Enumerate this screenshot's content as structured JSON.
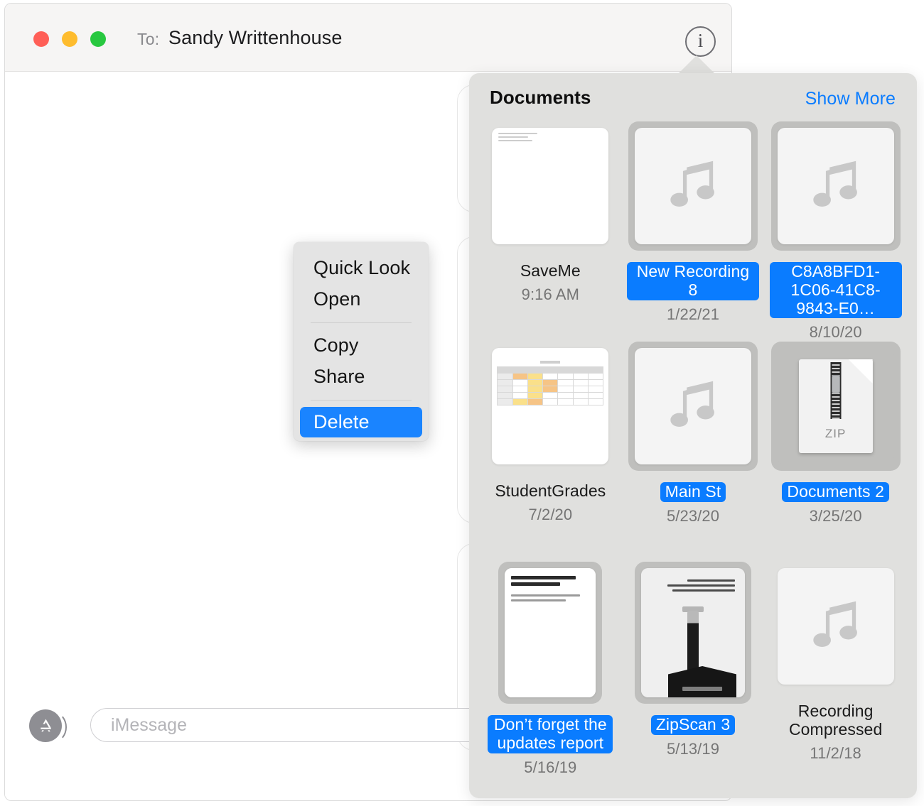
{
  "window": {
    "to_label": "To:",
    "recipient": "Sandy Writtenhouse",
    "info_button_glyph": "i",
    "composer_placeholder": "iMessage",
    "composer_value": ""
  },
  "context_menu": {
    "items": [
      {
        "label": "Quick Look",
        "selected": false
      },
      {
        "label": "Open",
        "selected": false
      },
      {
        "label": "Copy",
        "selected": false
      },
      {
        "label": "Share",
        "selected": false
      },
      {
        "label": "Delete",
        "selected": true
      }
    ]
  },
  "popover": {
    "title": "Documents",
    "show_more": "Show More",
    "items": [
      {
        "name": "SaveMe",
        "date": "9:16 AM",
        "selected": false,
        "kind": "document"
      },
      {
        "name": "New Recording 8",
        "date": "1/22/21",
        "selected": true,
        "kind": "audio"
      },
      {
        "name": "C8A8BFD1-1C06-41C8-9843-E0…",
        "date": "8/10/20",
        "selected": true,
        "kind": "audio"
      },
      {
        "name": "StudentGrades",
        "date": "7/2/20",
        "selected": false,
        "kind": "spreadsheet"
      },
      {
        "name": "Main St",
        "date": "5/23/20",
        "selected": true,
        "kind": "audio"
      },
      {
        "name": "Documents 2",
        "date": "3/25/20",
        "selected": true,
        "kind": "zip",
        "zip_label": "ZIP"
      },
      {
        "name": "Don’t forget the updates report",
        "date": "5/16/19",
        "selected": true,
        "kind": "note"
      },
      {
        "name": "ZipScan 3",
        "date": "5/13/19",
        "selected": true,
        "kind": "scan"
      },
      {
        "name": "Recording Compressed",
        "date": "11/2/18",
        "selected": false,
        "kind": "audio"
      }
    ]
  },
  "colors": {
    "accent_blue": "#0a7cff",
    "menu_highlight": "#1a84ff",
    "popover_bg": "#e0e0de",
    "titlebar_bg": "#f6f5f4",
    "traffic_red": "#ff5f57",
    "traffic_yellow": "#febc2e",
    "traffic_green": "#28c840"
  }
}
